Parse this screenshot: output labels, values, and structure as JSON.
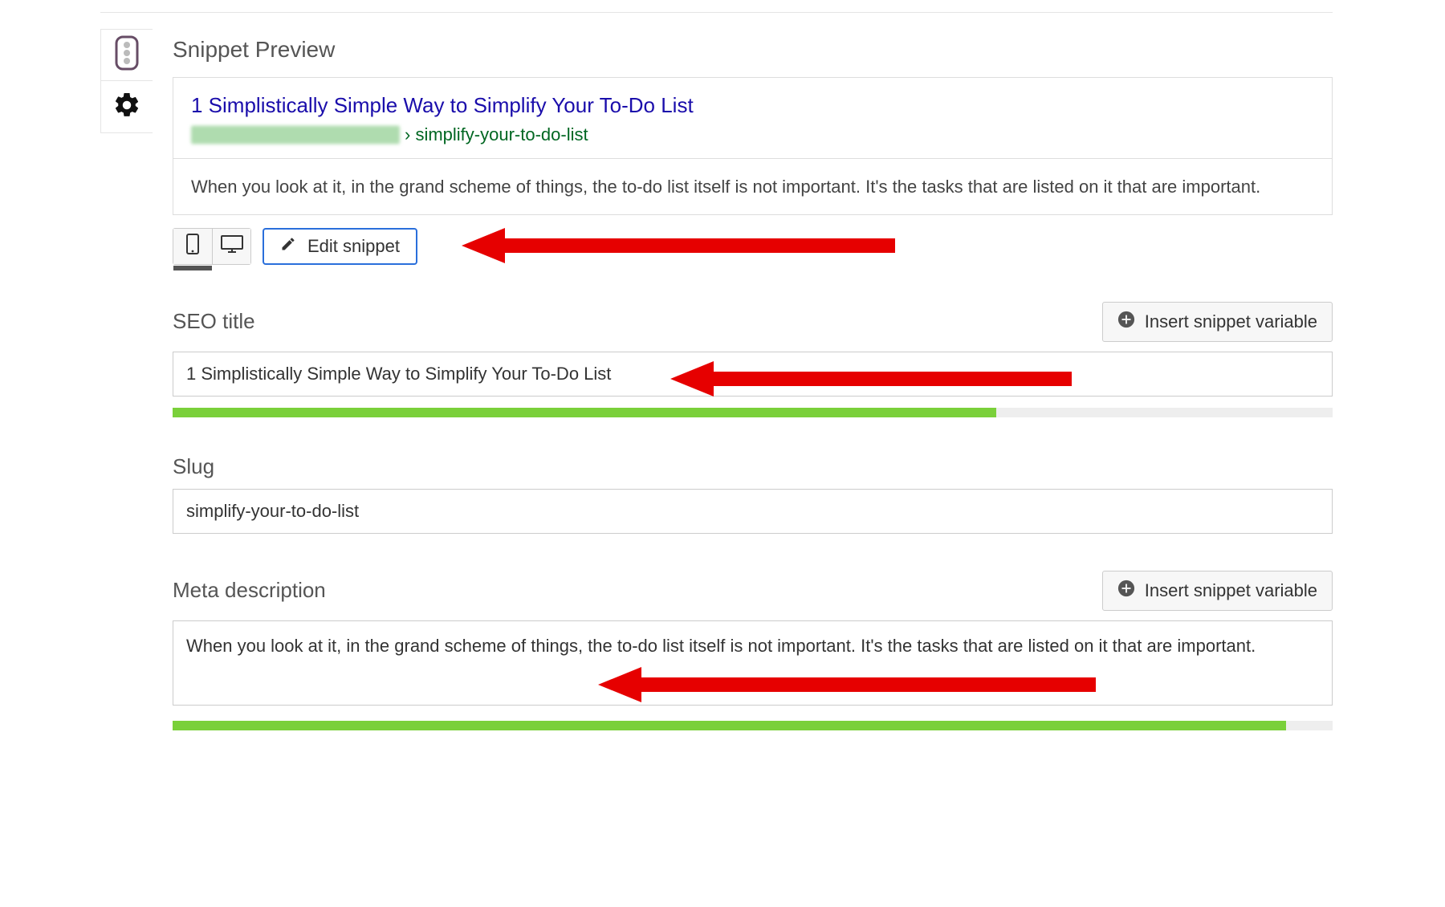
{
  "header": {
    "title": "Snippet Preview"
  },
  "preview": {
    "title": "1 Simplistically Simple Way to Simplify Your To-Do List",
    "slug_display": "› simplify-your-to-do-list",
    "description": "When you look at it, in the grand scheme of things, the to-do list itself is not important. It's the tasks that are listed on it that are important."
  },
  "toolbar": {
    "edit_label": "Edit snippet"
  },
  "fields": {
    "seo_title": {
      "label": "SEO title",
      "value": "1 Simplistically Simple Way to Simplify Your To-Do List",
      "insert_label": "Insert snippet variable",
      "progress_pct": 71
    },
    "slug": {
      "label": "Slug",
      "value": "simplify-your-to-do-list"
    },
    "meta_description": {
      "label": "Meta description",
      "value": "When you look at it, in the grand scheme of things, the to-do list itself is not important. It's the tasks that are listed on it that are important.",
      "insert_label": "Insert snippet variable",
      "progress_pct": 96
    }
  },
  "icons": {
    "mobile": "mobile-icon",
    "desktop": "desktop-icon",
    "pencil": "pencil-icon",
    "plus": "plus-circle-icon",
    "gear": "gear-icon",
    "traffic": "traffic-light-icon"
  },
  "colors": {
    "link": "#1a0dab",
    "url": "#006621",
    "progress": "#7ad03a",
    "accent_border": "#2a6fdb",
    "arrow": "#e60000"
  }
}
